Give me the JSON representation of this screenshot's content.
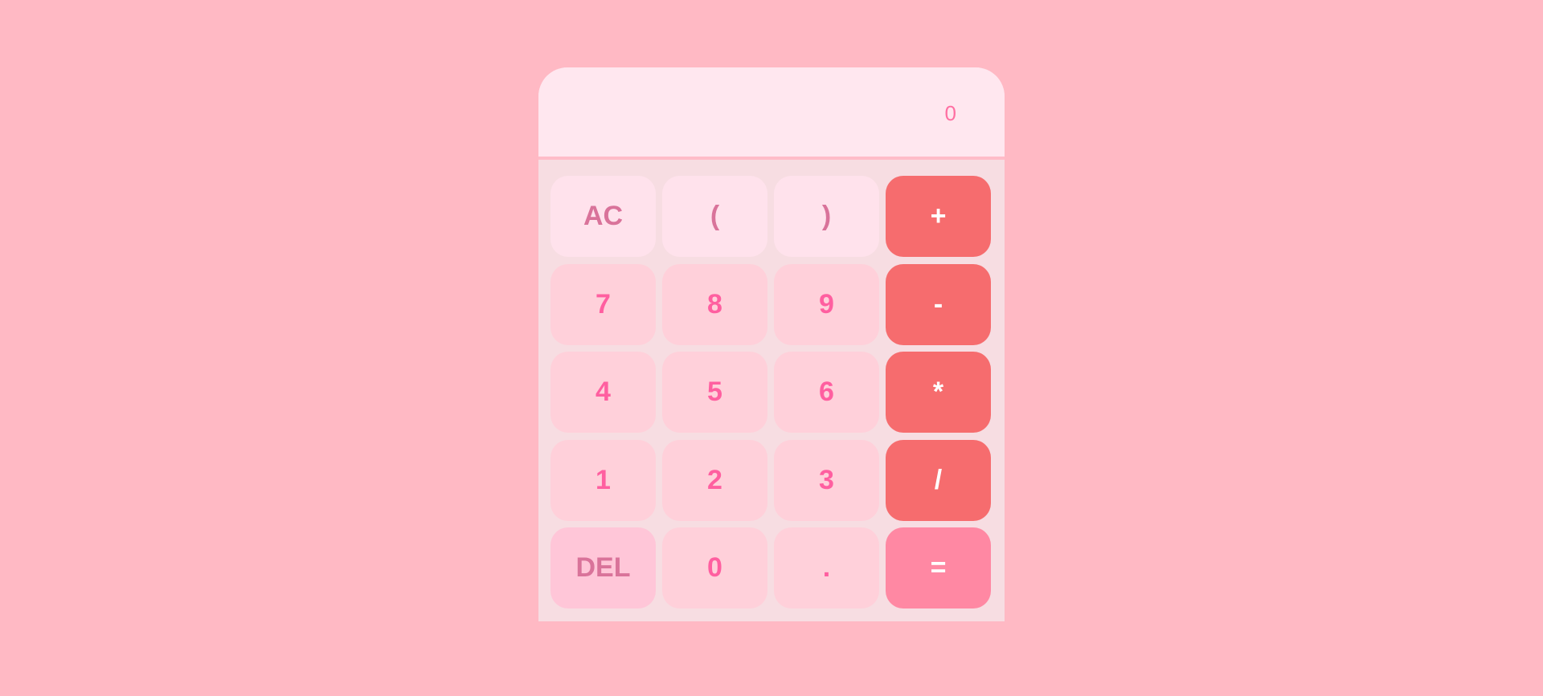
{
  "display": {
    "value": "0"
  },
  "keys": [
    {
      "label": "AC",
      "kind": "func",
      "name": "all-clear-button"
    },
    {
      "label": "(",
      "kind": "func",
      "name": "open-paren-button"
    },
    {
      "label": ")",
      "kind": "func",
      "name": "close-paren-button"
    },
    {
      "label": "+",
      "kind": "op",
      "name": "plus-button"
    },
    {
      "label": "7",
      "kind": "num",
      "name": "digit-7-button"
    },
    {
      "label": "8",
      "kind": "num",
      "name": "digit-8-button"
    },
    {
      "label": "9",
      "kind": "num",
      "name": "digit-9-button"
    },
    {
      "label": "-",
      "kind": "op",
      "name": "minus-button"
    },
    {
      "label": "4",
      "kind": "num",
      "name": "digit-4-button"
    },
    {
      "label": "5",
      "kind": "num",
      "name": "digit-5-button"
    },
    {
      "label": "6",
      "kind": "num",
      "name": "digit-6-button"
    },
    {
      "label": "*",
      "kind": "op",
      "name": "multiply-button"
    },
    {
      "label": "1",
      "kind": "num",
      "name": "digit-1-button"
    },
    {
      "label": "2",
      "kind": "num",
      "name": "digit-2-button"
    },
    {
      "label": "3",
      "kind": "num",
      "name": "digit-3-button"
    },
    {
      "label": "/",
      "kind": "op",
      "name": "divide-button"
    },
    {
      "label": "DEL",
      "kind": "del",
      "name": "delete-button"
    },
    {
      "label": "0",
      "kind": "num",
      "name": "digit-0-button"
    },
    {
      "label": ".",
      "kind": "num",
      "name": "decimal-point-button"
    },
    {
      "label": "=",
      "kind": "eq",
      "name": "equals-button"
    }
  ],
  "colors": {
    "background": "#ffb9c4",
    "display_bg": "#ffe7ef",
    "display_text": "#ff6fa2",
    "operator_key": "#f66c6e",
    "equals_key": "#ff88a3",
    "number_key": "#ffd0da",
    "function_key": "#ffe2ec"
  }
}
